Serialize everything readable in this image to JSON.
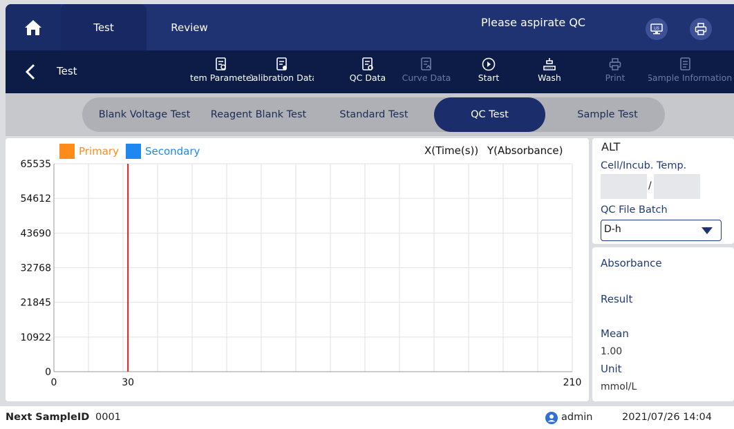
{
  "topbar": {
    "tabs": [
      {
        "label": "Test",
        "active": true
      },
      {
        "label": "Review",
        "active": false
      }
    ],
    "prompt": "Please aspirate QC",
    "icons": [
      "home-icon",
      "lis-icon",
      "printer-icon"
    ]
  },
  "toolbar": {
    "title": "Test",
    "buttons": [
      {
        "label": "Item Parameter",
        "icon": "item-parameter-icon",
        "enabled": true
      },
      {
        "label": "Calibration Data",
        "icon": "calibration-data-icon",
        "enabled": true
      },
      {
        "label": "QC Data",
        "icon": "qc-data-icon",
        "enabled": true
      },
      {
        "label": "Curve Data",
        "icon": "curve-data-icon",
        "enabled": false
      },
      {
        "label": "Start",
        "icon": "start-icon",
        "enabled": true
      },
      {
        "label": "Wash",
        "icon": "wash-icon",
        "enabled": true
      },
      {
        "label": "Print",
        "icon": "print-icon",
        "enabled": false
      },
      {
        "label": "Sample Information",
        "icon": "sample-information-icon",
        "enabled": false
      }
    ]
  },
  "test_tabs": [
    {
      "label": "Blank Voltage Test",
      "active": false
    },
    {
      "label": "Reagent Blank Test",
      "active": false
    },
    {
      "label": "Standard Test",
      "active": false
    },
    {
      "label": "QC Test",
      "active": true
    },
    {
      "label": "Sample Test",
      "active": false
    }
  ],
  "chart_data": {
    "type": "line",
    "legend": [
      {
        "name": "Primary",
        "color": "#ff8c1a"
      },
      {
        "name": "Secondary",
        "color": "#1e88f0"
      }
    ],
    "xlabel": "X(Time(s))",
    "ylabel": "Y(Absorbance)",
    "xlim": [
      0,
      210
    ],
    "ylim": [
      0,
      65535
    ],
    "x_ticks": [
      "0",
      "30",
      "210"
    ],
    "y_ticks": [
      "0",
      "10922",
      "21845",
      "32768",
      "43690",
      "54612",
      "65535"
    ],
    "x_tick_values": [
      0,
      30,
      210
    ],
    "y_tick_values": [
      0,
      10922,
      21845,
      32768,
      43690,
      54612,
      65535
    ],
    "grid": true,
    "marker_x": 30,
    "marker_color": "#d61f1f",
    "series": [
      {
        "name": "Primary",
        "values": []
      },
      {
        "name": "Secondary",
        "values": []
      }
    ]
  },
  "info": {
    "item": "ALT",
    "temp_label": "Cell/Incub. Temp.",
    "temp_cell": "",
    "temp_separator": "/",
    "temp_incub": "",
    "qc_batch_label": "QC File Batch",
    "qc_batch_value": "D-h",
    "absorbance_label": "Absorbance",
    "result_label": "Result",
    "mean_label": "Mean",
    "mean_value": "1.00",
    "unit_label": "Unit",
    "unit_value": "mmol/L"
  },
  "status": {
    "next_sample_label": "Next SampleID",
    "next_sample_value": "0001",
    "user": "admin",
    "datetime": "2021/07/26 14:04"
  }
}
